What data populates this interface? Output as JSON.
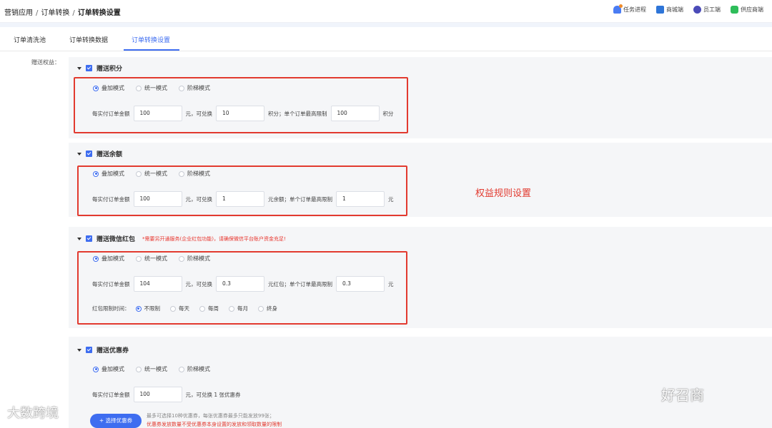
{
  "breadcrumb": [
    "营销应用",
    "订单转换",
    "订单转换设置"
  ],
  "breadcrumb_sep": "/",
  "top_actions": [
    {
      "label": "任务进程",
      "icon": "bell-icon"
    },
    {
      "label": "商城端",
      "icon": "store-qr-icon"
    },
    {
      "label": "员工端",
      "icon": "staff-icon"
    },
    {
      "label": "供应商端",
      "icon": "supplier-icon"
    }
  ],
  "tabs": [
    {
      "label": "订单清洗池",
      "active": false
    },
    {
      "label": "订单转换数据",
      "active": false
    },
    {
      "label": "订单转换设置",
      "active": true
    }
  ],
  "side_label": "赠送权益：",
  "modes": [
    "叠加模式",
    "统一模式",
    "阶梯模式"
  ],
  "sections": {
    "points": {
      "title": "赠送积分",
      "checked": true,
      "selected_mode": "叠加模式",
      "label_amount": "每实付订单金额",
      "amount": "100",
      "label_exchange": "元，可兑换",
      "exchange": "10",
      "label_limit": "积分；单个订单最高限制",
      "limit": "100",
      "unit": "积分"
    },
    "balance": {
      "title": "赠送余额",
      "checked": true,
      "selected_mode": "叠加模式",
      "label_amount": "每实付订单金额",
      "amount": "100",
      "label_exchange": "元，可兑换",
      "exchange": "1",
      "label_limit": "元余额；单个订单最高限制",
      "limit": "1",
      "unit": "元"
    },
    "redpacket": {
      "title": "赠送微信红包",
      "checked": true,
      "note": "*需要另开通服务(企业红包功能)，请确保微信平台账户资金充足!",
      "selected_mode": "叠加模式",
      "label_amount": "每实付订单金额",
      "amount": "104",
      "label_exchange": "元，可兑换",
      "exchange": "0.3",
      "label_limit": "元红包；单个订单最高限制",
      "limit": "0.3",
      "unit": "元",
      "time_label": "红包限制时间：",
      "time_options": [
        "不限制",
        "每天",
        "每周",
        "每月",
        "终身"
      ],
      "time_selected": "不限制"
    },
    "coupon": {
      "title": "赠送优惠券",
      "checked": true,
      "selected_mode": "叠加模式",
      "label_amount": "每实付订单金额",
      "amount": "100",
      "label_exchange": "元，可兑换 1 张优惠券",
      "button": "+ 选择优惠券",
      "tip": "最多可选择10种优惠券，每张优惠券最多只能发放99张；",
      "tip2": "优惠券发放数量不受优惠券本身设置的发放和领取数量的限制"
    }
  },
  "annotation": "权益规则设置",
  "watermarks": [
    "大数跨境",
    "好召商"
  ],
  "colors": {
    "accent": "#3e6df0",
    "highlight_box": "#e23a2f",
    "panel_bg": "#f5f6f8"
  }
}
